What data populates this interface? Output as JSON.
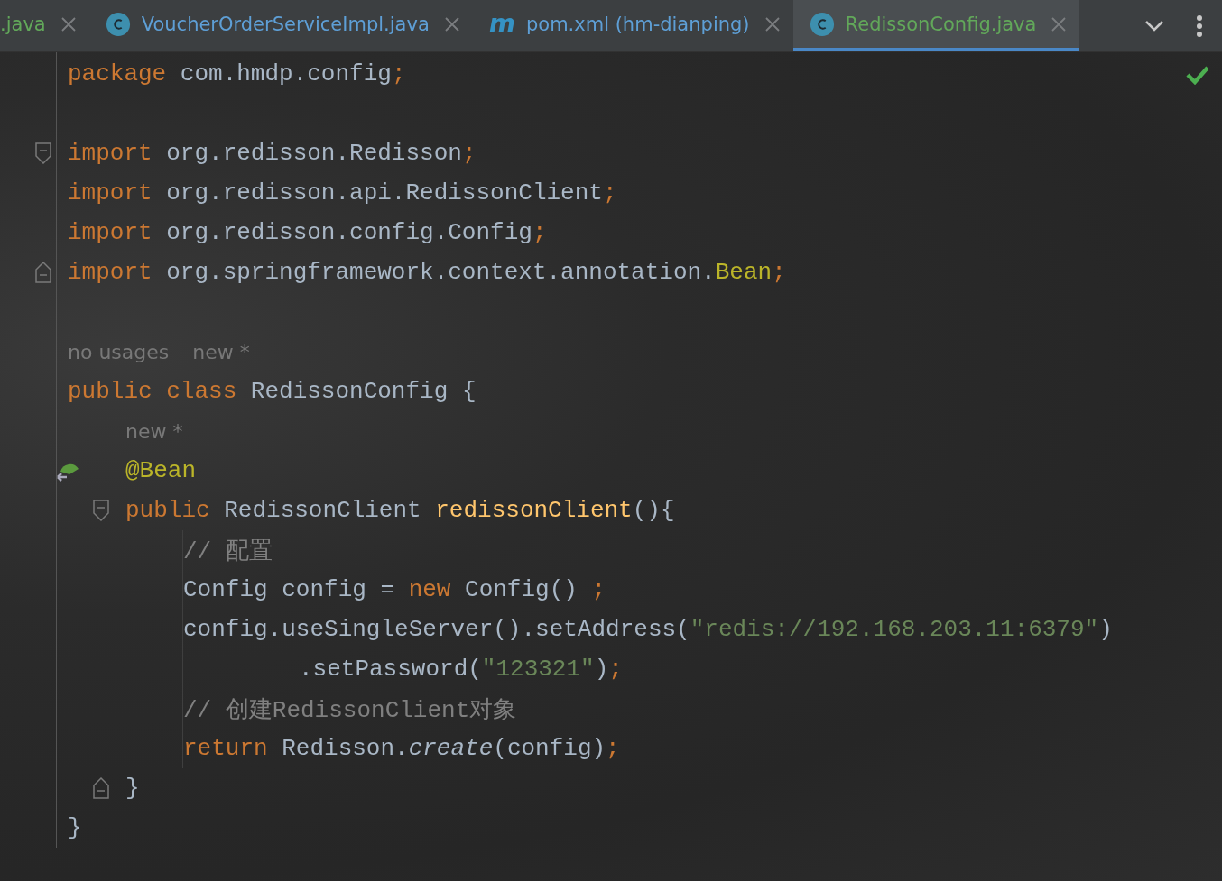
{
  "tabs": [
    {
      "label": ".java",
      "color": "#62a85a",
      "selected": false
    },
    {
      "label": "VoucherOrderServiceImpl.java",
      "icon": {
        "kind": "class"
      },
      "color": "#5e9fd6",
      "selected": false
    },
    {
      "label": "pom.xml (hm-dianping)",
      "icon": {
        "kind": "maven",
        "text": "m"
      },
      "color": "#5e9fd6",
      "selected": false
    },
    {
      "label": "RedissonConfig.java",
      "icon": {
        "kind": "class"
      },
      "color": "#62a85a",
      "selected": true
    }
  ],
  "inspection": {
    "ok": true
  },
  "lines": [
    {
      "kind": "code",
      "tokens": [
        {
          "kind": "keyword",
          "text": "package "
        },
        {
          "kind": "plain",
          "text": "com.hmdp.config"
        },
        {
          "kind": "punct",
          "text": ";"
        }
      ]
    },
    {
      "kind": "blank"
    },
    {
      "kind": "code",
      "gutter": {
        "kind": "fold-start"
      },
      "tokens": [
        {
          "kind": "keyword",
          "text": "import "
        },
        {
          "kind": "plain",
          "text": "org.redisson.Redisson"
        },
        {
          "kind": "punct",
          "text": ";"
        }
      ]
    },
    {
      "kind": "code",
      "tokens": [
        {
          "kind": "keyword",
          "text": "import "
        },
        {
          "kind": "plain",
          "text": "org.redisson.api.RedissonClient"
        },
        {
          "kind": "punct",
          "text": ";"
        }
      ]
    },
    {
      "kind": "code",
      "tokens": [
        {
          "kind": "keyword",
          "text": "import "
        },
        {
          "kind": "plain",
          "text": "org.redisson.config.Config"
        },
        {
          "kind": "punct",
          "text": ";"
        }
      ]
    },
    {
      "kind": "code",
      "gutter": {
        "kind": "fold-end"
      },
      "tokens": [
        {
          "kind": "keyword",
          "text": "import "
        },
        {
          "kind": "plain",
          "text": "org.springframework.context.annotation."
        },
        {
          "kind": "annotation",
          "text": "Bean"
        },
        {
          "kind": "punct",
          "text": ";"
        }
      ]
    },
    {
      "kind": "blank"
    },
    {
      "kind": "hint",
      "tokens": [
        {
          "text": "no usages"
        },
        {
          "text": "new *"
        }
      ]
    },
    {
      "kind": "code",
      "tokens": [
        {
          "kind": "keyword",
          "text": "public class "
        },
        {
          "kind": "plain",
          "text": "RedissonConfig {"
        }
      ],
      "children": [
        {
          "kind": "hint",
          "tokens": [
            {
              "text": "new *"
            }
          ]
        },
        {
          "kind": "code",
          "gutter": {
            "kind": "bean"
          },
          "tokens": [
            {
              "kind": "annotation",
              "text": "@Bean"
            }
          ]
        },
        {
          "kind": "code",
          "gutter": {
            "kind": "fold-start"
          },
          "tokens": [
            {
              "kind": "keyword",
              "text": "public "
            },
            {
              "kind": "plain",
              "text": "RedissonClient "
            },
            {
              "kind": "method",
              "text": "redissonClient"
            },
            {
              "kind": "plain",
              "text": "(){"
            }
          ],
          "children": [
            {
              "kind": "code",
              "tokens": [
                {
                  "kind": "comment",
                  "text": "// 配置"
                }
              ]
            },
            {
              "kind": "code",
              "tokens": [
                {
                  "kind": "plain",
                  "text": "Config config = "
                },
                {
                  "kind": "keyword",
                  "text": "new "
                },
                {
                  "kind": "plain",
                  "text": "Config() "
                },
                {
                  "kind": "punct",
                  "text": ";"
                }
              ]
            },
            {
              "kind": "code",
              "tokens": [
                {
                  "kind": "plain",
                  "text": "config.useSingleServer().setAddress("
                },
                {
                  "kind": "string",
                  "text": "\"redis://192.168.203.11:6379\""
                },
                {
                  "kind": "plain",
                  "text": ")"
                }
              ],
              "continuation": [
                {
                  "kind": "code",
                  "tokens": [
                    {
                      "kind": "plain",
                      "text": ".setPassword("
                    },
                    {
                      "kind": "string",
                      "text": "\"123321\""
                    },
                    {
                      "kind": "plain",
                      "text": ")"
                    },
                    {
                      "kind": "punct",
                      "text": ";"
                    }
                  ]
                }
              ]
            },
            {
              "kind": "code",
              "tokens": [
                {
                  "kind": "comment",
                  "text": "// 创建RedissonClient对象"
                }
              ]
            },
            {
              "kind": "code",
              "tokens": [
                {
                  "kind": "keyword",
                  "text": "return "
                },
                {
                  "kind": "plain",
                  "text": "Redisson."
                },
                {
                  "kind": "italic",
                  "text": "create"
                },
                {
                  "kind": "plain",
                  "text": "(config)"
                },
                {
                  "kind": "punct",
                  "text": ";"
                }
              ]
            }
          ]
        },
        {
          "kind": "code",
          "gutter": {
            "kind": "fold-end"
          },
          "tokens": [
            {
              "kind": "plain",
              "text": "}"
            }
          ]
        }
      ]
    },
    {
      "kind": "code",
      "tokens": [
        {
          "kind": "plain",
          "text": "}"
        }
      ]
    }
  ]
}
